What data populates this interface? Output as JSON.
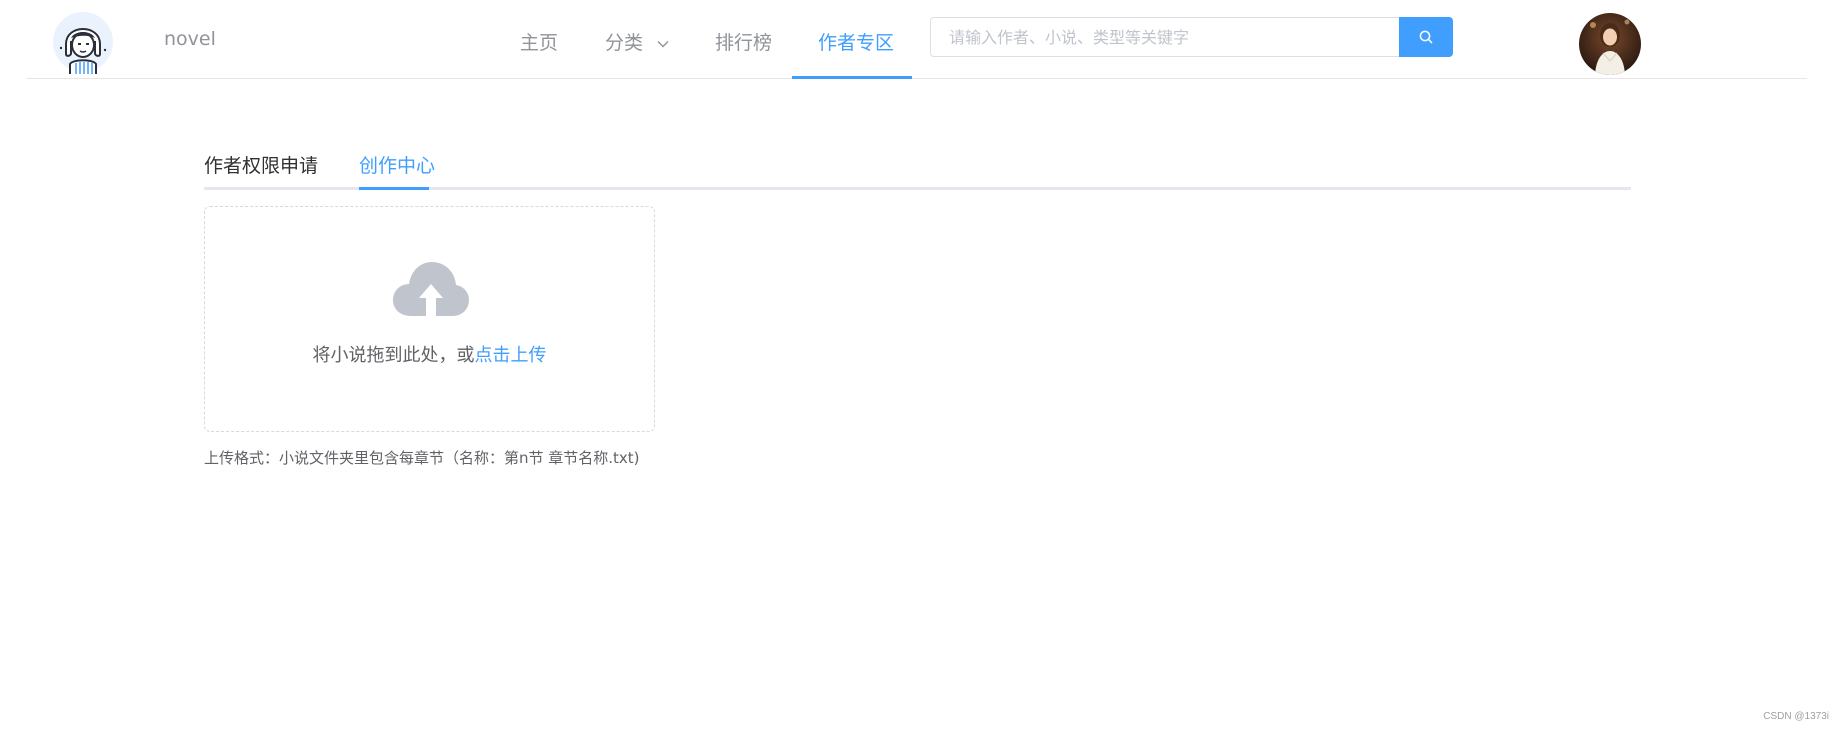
{
  "header": {
    "brand": "novel",
    "nav": {
      "home": "主页",
      "category": "分类",
      "ranking": "排行榜",
      "author_zone": "作者专区"
    },
    "search": {
      "placeholder": "请输入作者、小说、类型等关键字",
      "value": "",
      "icon": "search-icon"
    },
    "avatar_icon": "user-avatar"
  },
  "tabs": {
    "apply": "作者权限申请",
    "center": "创作中心",
    "active": "center"
  },
  "upload": {
    "icon": "cloud-upload-icon",
    "text_prefix": "将小说拖到此处，或",
    "text_link": "点击上传",
    "tip": "上传格式：小说文件夹里包含每章节（名称：第n节 章节名称.txt)"
  },
  "watermark": "CSDN @1373i",
  "colors": {
    "primary": "#409eff",
    "text": "#606266",
    "muted": "#909399",
    "border": "#dcdfe6",
    "icon_gray": "#c0c4cc"
  }
}
